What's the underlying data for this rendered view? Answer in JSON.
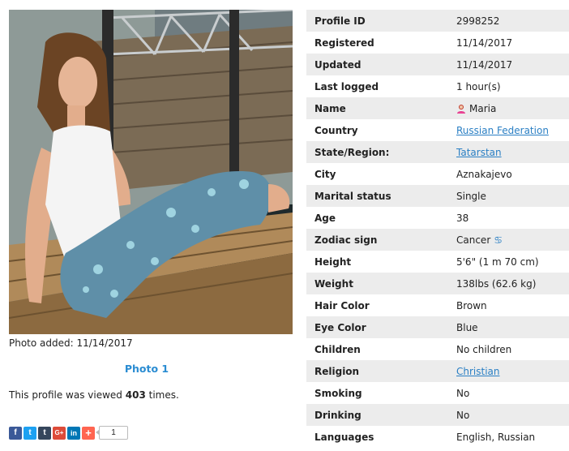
{
  "photo": {
    "added_label": "Photo added: 11/14/2017",
    "link_label": "Photo 1"
  },
  "views": {
    "prefix": "This profile was viewed",
    "count": "403",
    "suffix": "times."
  },
  "share": {
    "buttons": [
      {
        "name": "facebook-share-icon",
        "glyph": "f",
        "color": "#3b5998"
      },
      {
        "name": "twitter-share-icon",
        "glyph": "t",
        "color": "#1da1f2"
      },
      {
        "name": "tumblr-share-icon",
        "glyph": "t",
        "color": "#35465c"
      },
      {
        "name": "googleplus-share-icon",
        "glyph": "G+",
        "color": "#dd4b39"
      },
      {
        "name": "linkedin-share-icon",
        "glyph": "in",
        "color": "#0077b5"
      },
      {
        "name": "more-share-icon",
        "glyph": "+",
        "color": "#ff6550"
      }
    ],
    "count": "1"
  },
  "profile": {
    "rows": [
      {
        "label": "Profile ID",
        "value": "2998252"
      },
      {
        "label": "Registered",
        "value": "11/14/2017"
      },
      {
        "label": "Updated",
        "value": "11/14/2017"
      },
      {
        "label": "Last logged",
        "value": "1 hour(s)"
      },
      {
        "label": "Name",
        "value": "Maria",
        "icon": "female-user-icon"
      },
      {
        "label": "Country",
        "value": "Russian Federation",
        "link": true
      },
      {
        "label": "State/Region:",
        "value": "Tatarstan",
        "link": true
      },
      {
        "label": "City",
        "value": "Aznakajevo"
      },
      {
        "label": "Marital status",
        "value": "Single"
      },
      {
        "label": "Age",
        "value": "38"
      },
      {
        "label": "Zodiac sign",
        "value": "Cancer",
        "icon": "cancer-zodiac-icon"
      },
      {
        "label": "Height",
        "value": "5'6\" (1 m 70 cm)"
      },
      {
        "label": "Weight",
        "value": "138lbs (62.6 kg)"
      },
      {
        "label": "Hair Color",
        "value": "Brown"
      },
      {
        "label": "Eye Color",
        "value": "Blue"
      },
      {
        "label": "Children",
        "value": "No children"
      },
      {
        "label": "Religion",
        "value": "Christian",
        "link": true
      },
      {
        "label": "Smoking",
        "value": "No"
      },
      {
        "label": "Drinking",
        "value": "No"
      },
      {
        "label": "Languages",
        "value": "English, Russian"
      }
    ]
  },
  "colors": {
    "link": "#2a7fc4",
    "row_alt": "#ececec",
    "photo_link": "#2a8cd2"
  }
}
